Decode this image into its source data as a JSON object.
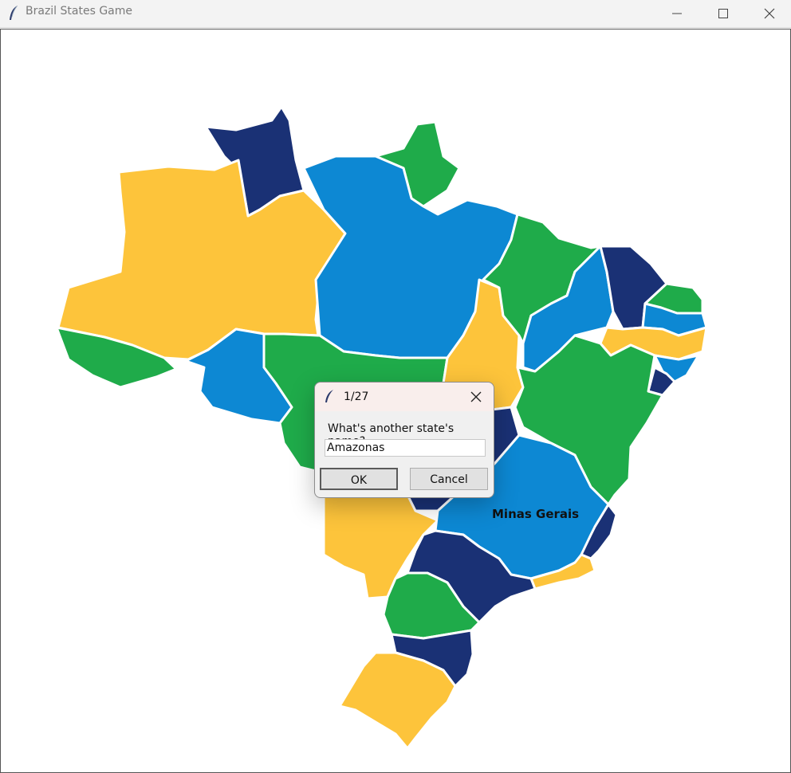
{
  "window": {
    "title": "Brazil States Game",
    "controls": [
      "minimize-icon",
      "maximize-icon",
      "close-icon"
    ]
  },
  "map": {
    "labels": [
      "Minas Gerais"
    ],
    "colors": {
      "yellow": "#fdc43b",
      "green": "#1fab4a",
      "blue": "#0d88d3",
      "navy": "#1a3175",
      "border": "#ffffff"
    }
  },
  "dialog": {
    "title": "1/27",
    "prompt": "What's another state's name?",
    "input_value": "Amazonas",
    "ok_label": "OK",
    "cancel_label": "Cancel"
  }
}
